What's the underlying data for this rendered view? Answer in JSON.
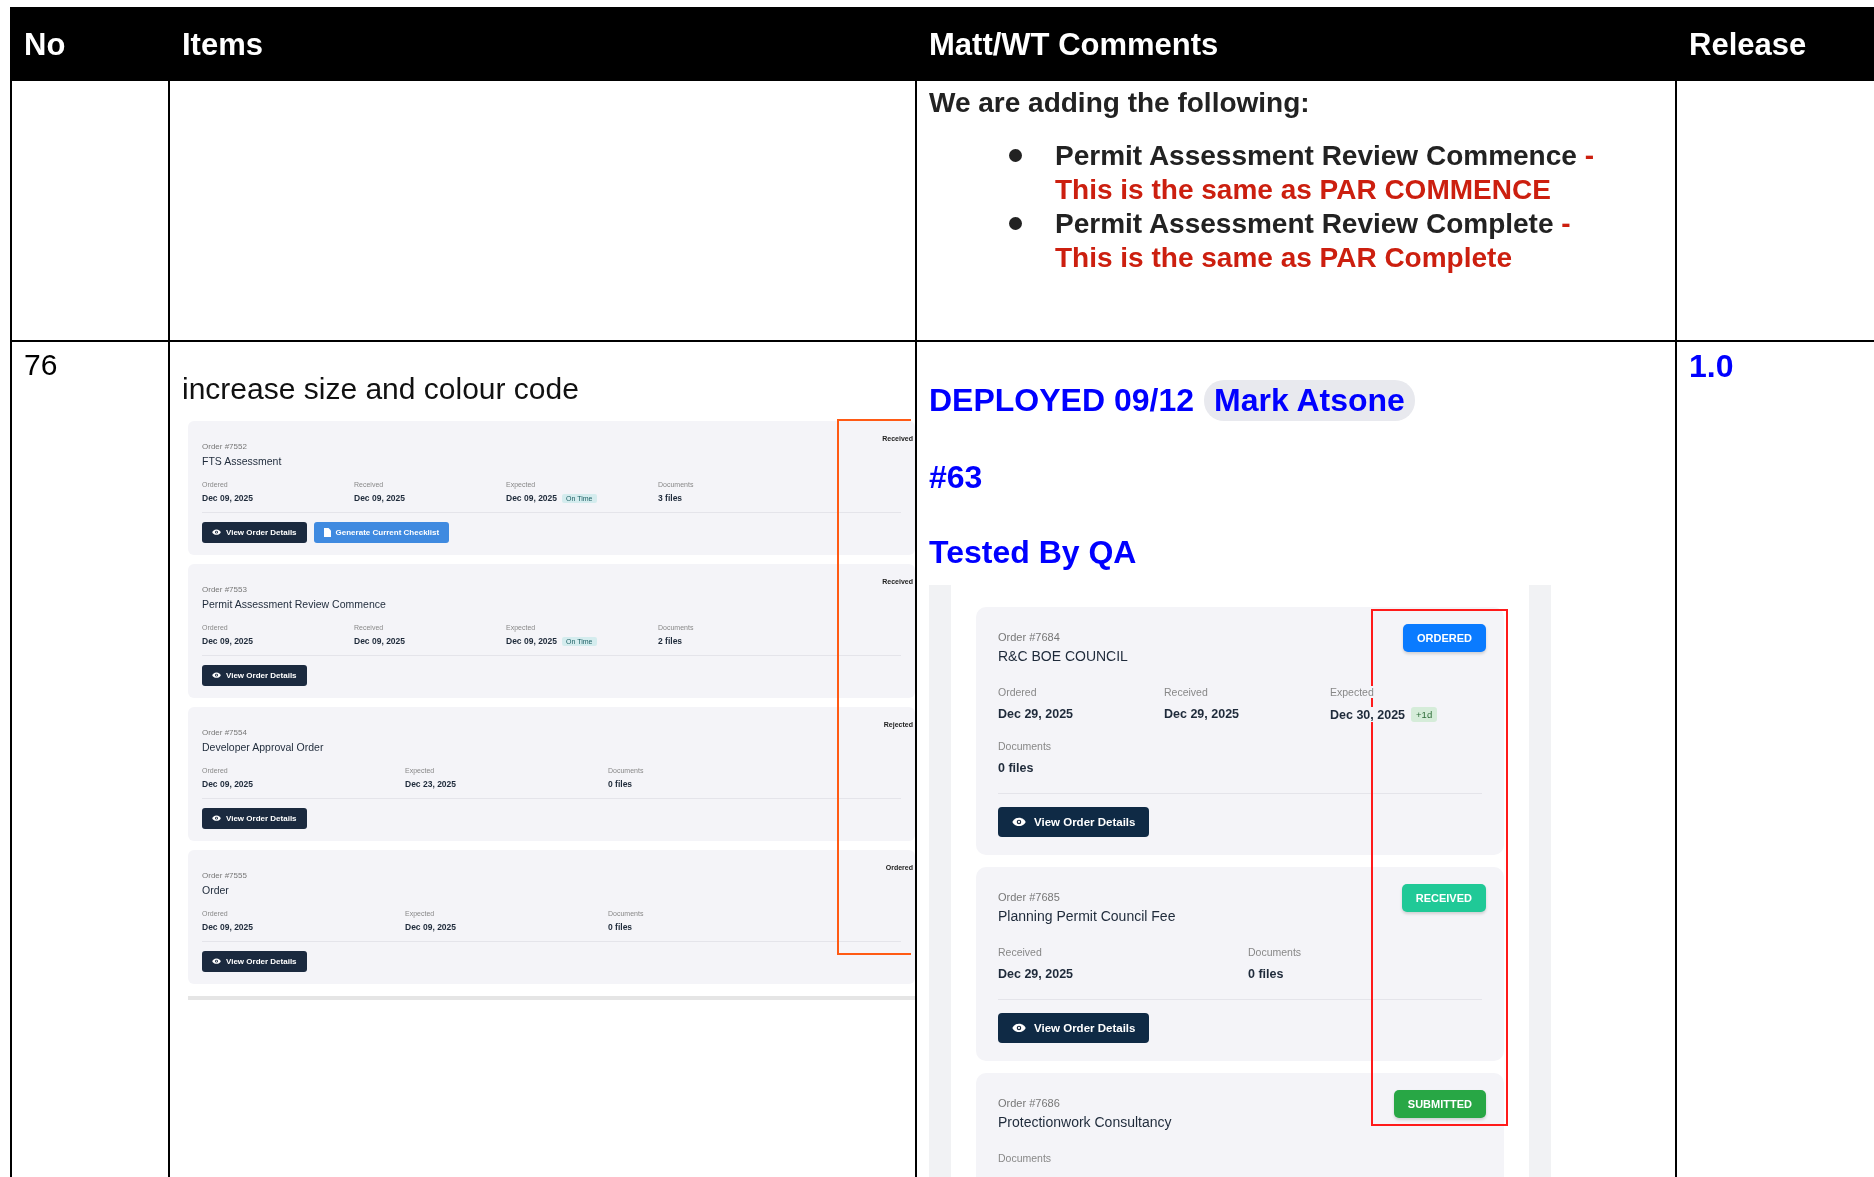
{
  "table": {
    "columns": [
      "No",
      "Items",
      "Matt/WT Comments",
      "Release"
    ],
    "rows": [
      {
        "no": "",
        "items": {},
        "comments": {
          "intro": "We are adding the following:",
          "bullets": [
            {
              "main": "Permit Assessment Review Commence",
              "note": "- This is the same as PAR COMMENCE"
            },
            {
              "main": "Permit Assessment Review Complete",
              "note": "- This is the same as PAR Complete"
            }
          ]
        },
        "release": ""
      },
      {
        "no": "76",
        "items": {
          "text": "increase size and colour code",
          "screenshot": {
            "cards": [
              {
                "order": "Order #7552",
                "title": "FTS Assessment",
                "status": "Received",
                "fields": [
                  {
                    "label": "Ordered",
                    "value": "Dec 09, 2025"
                  },
                  {
                    "label": "Received",
                    "value": "Dec 09, 2025"
                  },
                  {
                    "label": "Expected",
                    "value": "Dec 09, 2025",
                    "badge": "On Time"
                  },
                  {
                    "label": "Documents",
                    "value": "3 files"
                  }
                ],
                "buttons": [
                  {
                    "label": "View Order Details",
                    "kind": "dark"
                  },
                  {
                    "label": "Generate Current Checklist",
                    "kind": "blue"
                  }
                ]
              },
              {
                "order": "Order #7553",
                "title": "Permit Assessment Review Commence",
                "status": "Received",
                "fields": [
                  {
                    "label": "Ordered",
                    "value": "Dec 09, 2025"
                  },
                  {
                    "label": "Received",
                    "value": "Dec 09, 2025"
                  },
                  {
                    "label": "Expected",
                    "value": "Dec 09, 2025",
                    "badge": "On Time"
                  },
                  {
                    "label": "Documents",
                    "value": "2 files"
                  }
                ],
                "buttons": [
                  {
                    "label": "View Order Details",
                    "kind": "dark"
                  }
                ]
              },
              {
                "order": "Order #7554",
                "title": "Developer Approval Order",
                "status": "Rejected",
                "fields": [
                  {
                    "label": "Ordered",
                    "value": "Dec 09, 2025"
                  },
                  {
                    "label": "Expected",
                    "value": "Dec 23, 2025"
                  },
                  {
                    "label": "Documents",
                    "value": "0 files"
                  }
                ],
                "buttons": [
                  {
                    "label": "View Order Details",
                    "kind": "dark"
                  }
                ]
              },
              {
                "order": "Order #7555",
                "title": "Order",
                "status": "Ordered",
                "fields": [
                  {
                    "label": "Ordered",
                    "value": "Dec 09, 2025"
                  },
                  {
                    "label": "Expected",
                    "value": "Dec 09, 2025"
                  },
                  {
                    "label": "Documents",
                    "value": "0 files"
                  }
                ],
                "buttons": [
                  {
                    "label": "View Order Details",
                    "kind": "dark"
                  }
                ]
              }
            ]
          }
        },
        "comments": {
          "deployed": "DEPLOYED 09/12",
          "person": "Mark Atsone",
          "ref": "#63",
          "tested": "Tested By QA",
          "screenshot": {
            "cards": [
              {
                "order": "Order #7684",
                "title": "R&C BOE COUNCIL",
                "status": {
                  "label": "ORDERED",
                  "color": "#0a7bff"
                },
                "fields": [
                  {
                    "label": "Ordered",
                    "value": "Dec 29, 2025"
                  },
                  {
                    "label": "Received",
                    "value": "Dec 29, 2025"
                  },
                  {
                    "label": "Expected",
                    "value": "Dec 30, 2025",
                    "badge": "+1d"
                  },
                  {
                    "label": "Documents",
                    "value": "0 files"
                  }
                ],
                "button": "View Order Details"
              },
              {
                "order": "Order #7685",
                "title": "Planning Permit Council Fee",
                "status": {
                  "label": "RECEIVED",
                  "color": "#20c997"
                },
                "fields": [
                  {
                    "label": "Received",
                    "value": "Dec 29, 2025"
                  },
                  {
                    "label": "Documents",
                    "value": "0 files"
                  }
                ],
                "button": "View Order Details"
              },
              {
                "order": "Order #7686",
                "title": "Protectionwork Consultancy",
                "status": {
                  "label": "SUBMITTED",
                  "color": "#28a745"
                },
                "fields": [
                  {
                    "label": "Documents"
                  }
                ]
              }
            ]
          }
        },
        "release": "1.0"
      }
    ]
  }
}
